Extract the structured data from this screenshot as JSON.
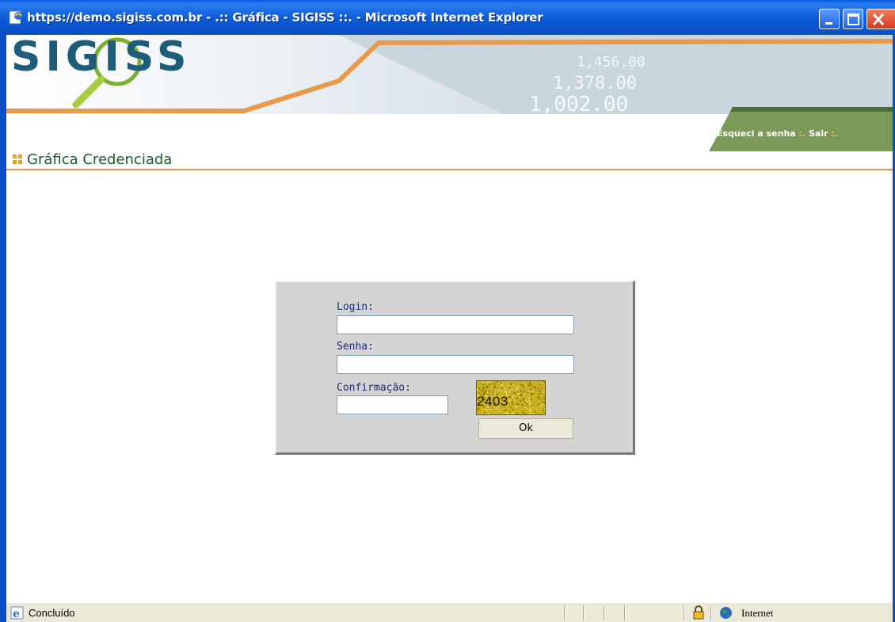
{
  "window": {
    "title": "https://demo.sigiss.com.br - .:: Gráfica - SIGISS ::. - Microsoft Internet Explorer"
  },
  "banner": {
    "logo_text": "SIGISS",
    "links": {
      "forgot_password": "Esqueci a senha",
      "separator": ":.",
      "logout": "Sair"
    }
  },
  "page": {
    "title": "Gráfica Credenciada"
  },
  "login_form": {
    "login_label": "Login:",
    "login_value": "",
    "password_label": "Senha:",
    "password_value": "",
    "confirmation_label": "Confirmação:",
    "confirmation_value": "",
    "captcha_text": "2403",
    "ok_label": "Ok"
  },
  "statusbar": {
    "status_text": "Concluído",
    "zone_text": "Internet"
  },
  "colors": {
    "titlebar_blue": "#0a5fe6",
    "banner_orange": "#e89a4a",
    "banner_green": "#7a9a5a",
    "page_title_green": "#1e5c2a",
    "bullet_orange": "#e8a020"
  }
}
